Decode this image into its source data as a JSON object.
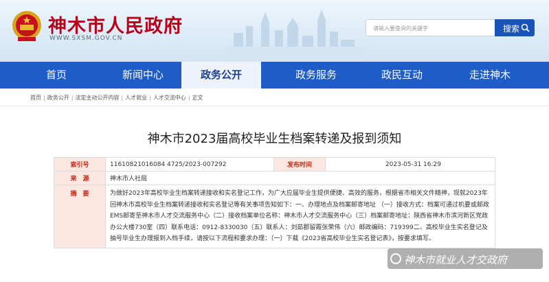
{
  "header": {
    "site_title": "神木市人民政府",
    "site_url": "WWW.SXSM.GOV.CN",
    "search": {
      "placeholder": "请输入要查询的关键字",
      "button_label": "搜索"
    }
  },
  "nav": {
    "items": [
      {
        "label": "首页"
      },
      {
        "label": "新闻中心"
      },
      {
        "label": "政务公开"
      },
      {
        "label": "政务服务"
      },
      {
        "label": "政民互动"
      },
      {
        "label": "走进神木"
      }
    ],
    "active_index": 2
  },
  "breadcrumb": [
    "首页",
    "政务公开",
    "法定主动公开内容",
    "人才就业",
    "人才交流中心",
    "正文"
  ],
  "article": {
    "title": "神木市2023届高校毕业生档案转递及报到须知",
    "meta": {
      "index_label": "索引号",
      "index_value": "11610821016084 4725/2023-007292",
      "published_label": "发布时间",
      "published_value": "2023-05-31 16:29",
      "source_label": "来　源",
      "source_value": "神木市人社局",
      "abstract_label": "摘　要",
      "abstract_value": "为做好2023年高校毕业生档案转递接收和实名登记工作，为广大应届毕业生提供便捷、高效的服务，根据省市相关文件精神，现就2023年回神木市高校毕业生档案转递接收和实名登记等有关事项告知如下：一、办理地点及档案邮寄地址 （一）接收方式：档案可通过机要或邮政EMS邮寄至神木市人才交流服务中心（二）接收档案单位名称：神木市人才交流服务中心（三）档案邮寄地址：陕西省神木市滨河新区党政办公大楼730室（四）联系电话：0912-8330030（五）联系人：刘茹郡留霞张荣伟（六）邮政编码：719399二、高校毕业生实名登记及抽号毕业生办理报到入档手续，请按以下流程和要求办理：（一）下载《2023省高校毕业生实名登记表》，按要求填写。"
    }
  },
  "watermark": {
    "text": "神木市就业人才交政府"
  }
}
